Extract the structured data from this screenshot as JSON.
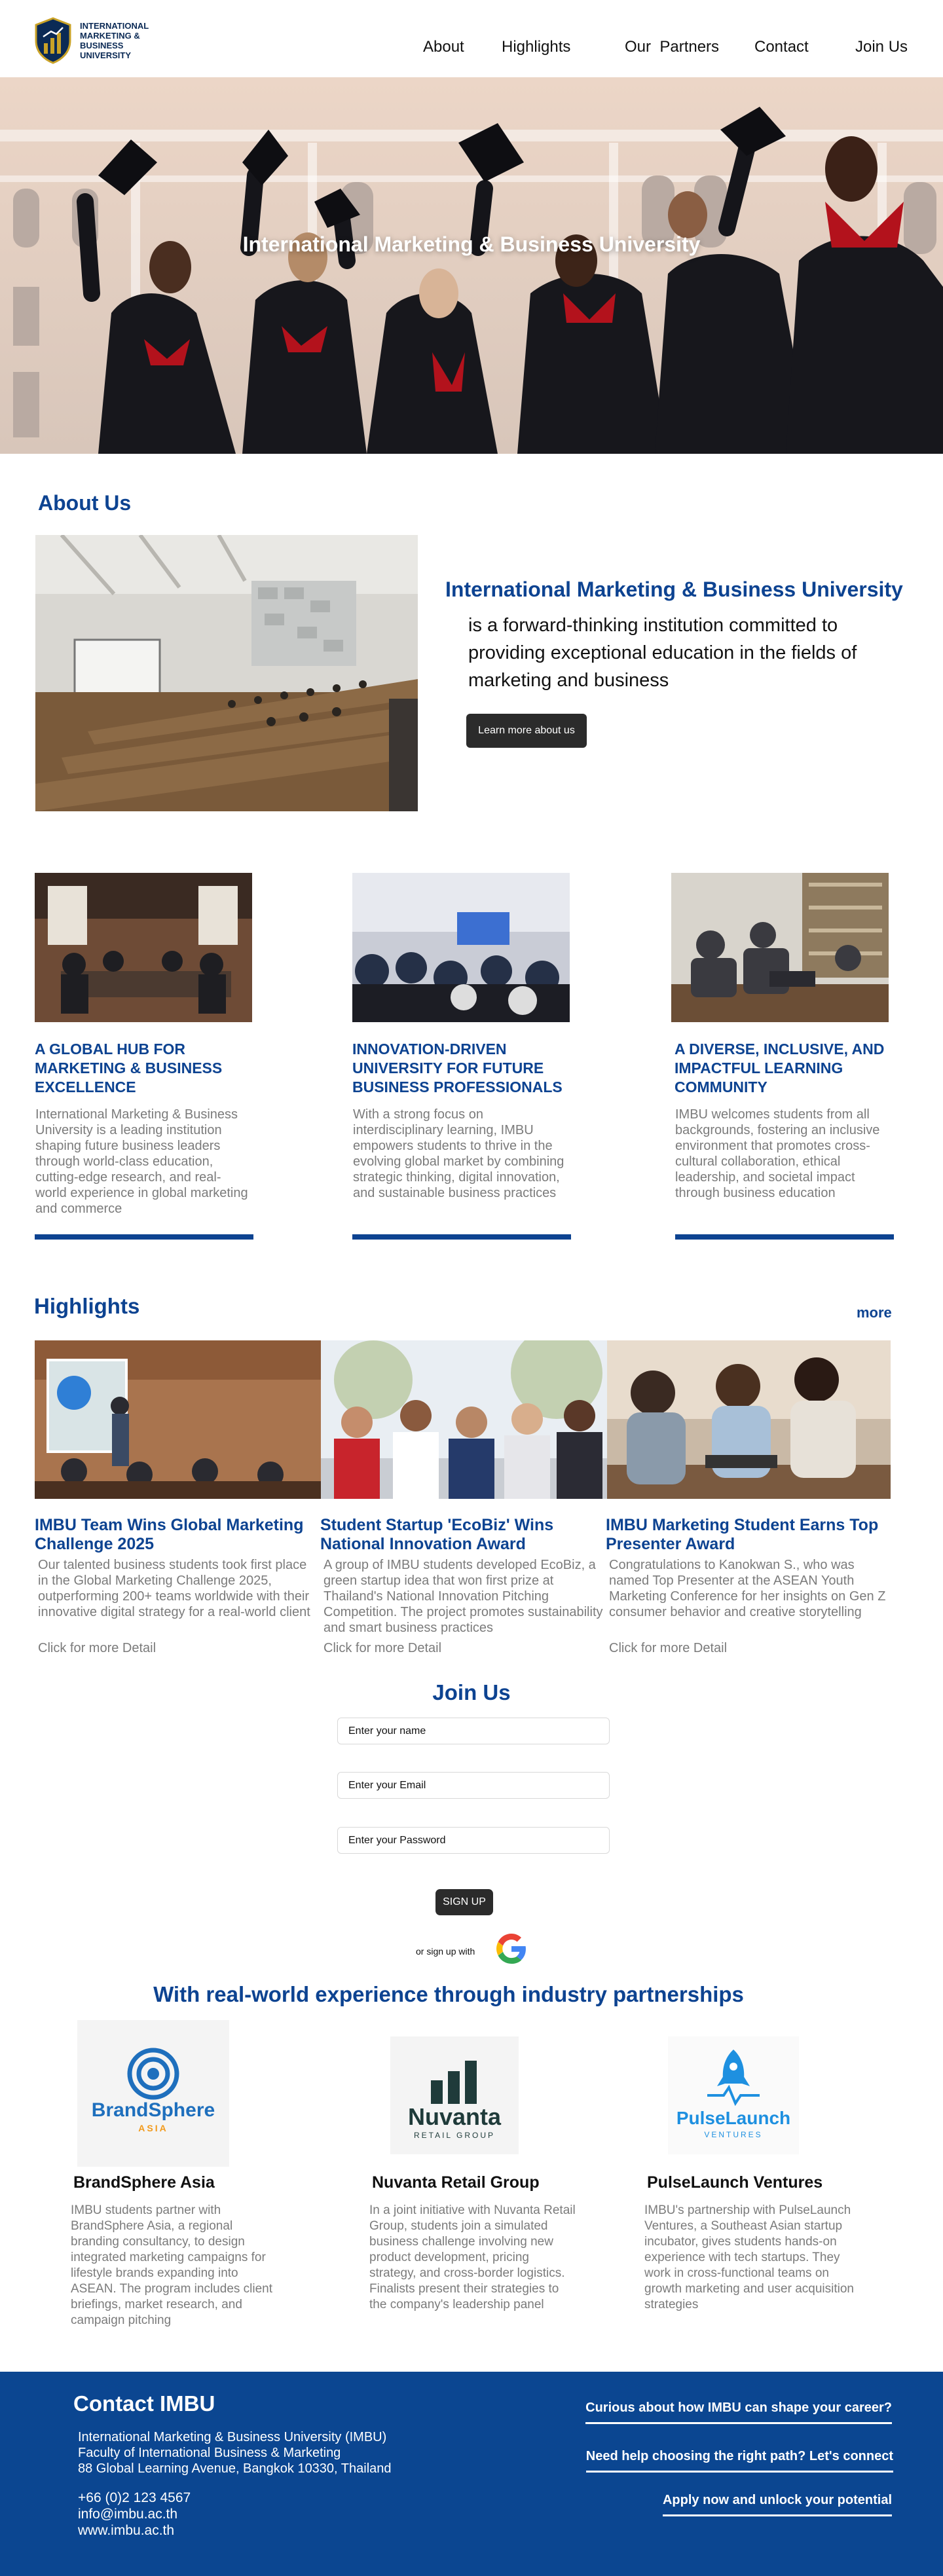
{
  "nav": {
    "logo_text": "INTERNATIONAL MARKETING & BUSINESS UNIVERSITY",
    "links": [
      "About",
      "Highlights",
      "Our  Partners",
      "Contact",
      "Join Us"
    ]
  },
  "hero": {
    "title": "International Marketing & Business University"
  },
  "about": {
    "heading": "About Us",
    "university": "International Marketing & Business University",
    "text": "is a forward-thinking institution committed to providing exceptional education in the fields of marketing and business",
    "button": "Learn more about us"
  },
  "cards": [
    {
      "title": "A GLOBAL HUB FOR MARKETING & BUSINESS EXCELLENCE",
      "body": "International Marketing & Business University is a leading institution shaping future business leaders through world-class education, cutting-edge research, and real-world experience in global marketing and commerce"
    },
    {
      "title": "INNOVATION-DRIVEN UNIVERSITY FOR FUTURE BUSINESS PROFESSIONALS",
      "body": "With a strong focus on interdisciplinary learning, IMBU empowers students to thrive in the evolving global market by combining strategic thinking, digital innovation, and sustainable business practices"
    },
    {
      "title": "A DIVERSE, INCLUSIVE, AND IMPACTFUL LEARNING COMMUNITY",
      "body": "IMBU welcomes students from all backgrounds, fostering an inclusive environment that promotes cross-cultural collaboration, ethical leadership, and societal impact through business education"
    }
  ],
  "highlights": {
    "heading": "Highlights",
    "more": "more",
    "items": [
      {
        "title": "IMBU Team Wins Global Marketing Challenge 2025",
        "body": "Our talented business students took first place in the Global Marketing Challenge 2025, outperforming 200+ teams worldwide with their innovative digital strategy for a real-world client",
        "click": "Click for more Detail"
      },
      {
        "title": "Student Startup 'EcoBiz' Wins National Innovation Award",
        "body": "A group of IMBU students developed EcoBiz, a green startup idea that won first prize at Thailand's National Innovation Pitching Competition. The project promotes sustainability and smart business practices",
        "click": "Click for more Detail"
      },
      {
        "title": "IMBU Marketing Student Earns Top Presenter Award",
        "body": "Congratulations to Kanokwan S., who was named Top Presenter at the ASEAN Youth Marketing Conference for her insights on Gen Z consumer behavior and creative storytelling",
        "click": "Click for more Detail"
      }
    ]
  },
  "join": {
    "heading": "Join Us",
    "name_placeholder": "Enter your name",
    "email_placeholder": "Enter your Email",
    "password_placeholder": "Enter your Password",
    "signup": "SIGN UP",
    "or_signup": "or sign up with"
  },
  "partners": {
    "heading": "With real-world experience through industry partnerships",
    "items": [
      {
        "logo_line1": "BrandSphere",
        "logo_line2": "ASIA",
        "name": "BrandSphere Asia",
        "body": "IMBU students partner with BrandSphere Asia, a regional branding consultancy, to design integrated marketing campaigns for lifestyle brands expanding into ASEAN. The program includes client briefings, market research, and campaign pitching"
      },
      {
        "logo_line1": "Nuvanta",
        "logo_line2": "RETAIL GROUP",
        "name": "Nuvanta Retail Group",
        "body": "In a joint initiative with Nuvanta Retail Group, students join a simulated business challenge involving new product development, pricing strategy, and cross-border logistics. Finalists present their strategies to the company's leadership panel"
      },
      {
        "logo_line1": "PulseLaunch",
        "logo_line2": "VENTURES",
        "name": "PulseLaunch Ventures",
        "body": "IMBU's partnership with PulseLaunch Ventures, a Southeast Asian startup incubator, gives students hands-on experience with tech startups. They work in cross-functional teams on growth marketing and user acquisition strategies"
      }
    ]
  },
  "footer": {
    "heading": "Contact IMBU",
    "address_line1": "International Marketing & Business University (IMBU)",
    "address_line2": "Faculty of International Business & Marketing",
    "address_line3": "88 Global Learning Avenue, Bangkok 10330, Thailand",
    "phone": "+66 (0)2 123 4567",
    "email": "info@imbu.ac.th",
    "website": "www.imbu.ac.th",
    "links": [
      "Curious about how IMBU can shape your career?",
      "Need help choosing the right path? Let's connect",
      "Apply now and unlock your potential"
    ]
  },
  "colors": {
    "brand_blue": "#0d4391",
    "footer_blue": "#0b4691",
    "dark_button": "#2b2b2b",
    "muted_text": "#7b7b7b"
  }
}
